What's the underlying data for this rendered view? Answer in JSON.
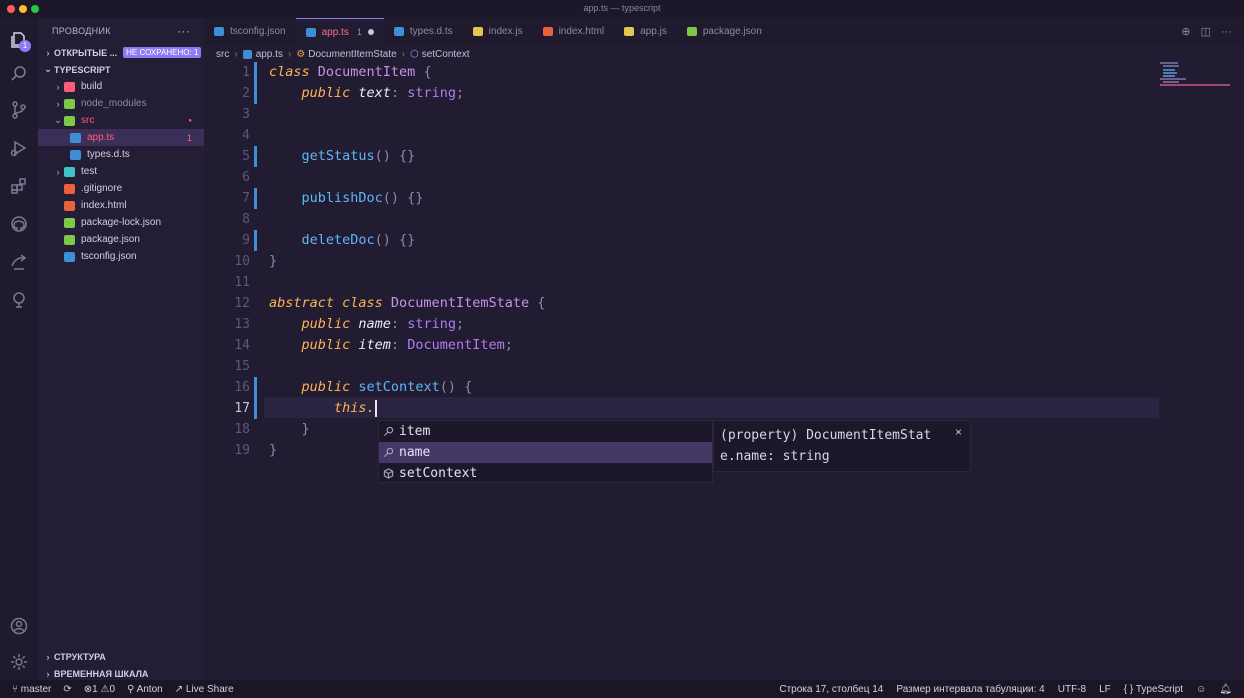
{
  "window": {
    "title": "app.ts — typescript"
  },
  "activity_bar": {
    "icons": [
      "files-icon",
      "search-icon",
      "source-control-icon",
      "run-debug-icon",
      "extensions-icon",
      "github-icon",
      "remote-icon",
      "tree-icon",
      "account-icon",
      "settings-gear-icon"
    ],
    "explorer_badge": "1"
  },
  "sidebar": {
    "header": "ПРОВОДНИК",
    "open_editors": {
      "label": "ОТКРЫТЫЕ ...",
      "badge": "НЕ СОХРАНЕНО: 1"
    },
    "project": "TYPESCRIPT",
    "tree": [
      {
        "name": "build",
        "type": "folder",
        "color": "#ff5c7a",
        "text_color": "#d3cde6"
      },
      {
        "name": "node_modules",
        "type": "folder",
        "color": "#7fc94a",
        "text_color": "#8f89a8"
      },
      {
        "name": "src",
        "type": "folder-open",
        "color": "#7fc94a",
        "text_color": "#ff5c7a"
      },
      {
        "name": "app.ts",
        "type": "ts",
        "color": "#3e8fd6",
        "text_color": "#ff5c7a",
        "count": "1",
        "selected": true
      },
      {
        "name": "types.d.ts",
        "type": "ts",
        "color": "#3e8fd6",
        "text_color": "#d3cde6"
      },
      {
        "name": "test",
        "type": "folder",
        "color": "#3ec1c9",
        "text_color": "#d3cde6"
      },
      {
        "name": ".gitignore",
        "type": "file",
        "color": "#e8623c",
        "text_color": "#d3cde6"
      },
      {
        "name": "index.html",
        "type": "file",
        "color": "#e8623c",
        "text_color": "#d3cde6"
      },
      {
        "name": "package-lock.json",
        "type": "file",
        "color": "#7fc94a",
        "text_color": "#d3cde6"
      },
      {
        "name": "package.json",
        "type": "file",
        "color": "#7fc94a",
        "text_color": "#d3cde6"
      },
      {
        "name": "tsconfig.json",
        "type": "ts",
        "color": "#3e8fd6",
        "text_color": "#d3cde6"
      }
    ],
    "structure": "СТРУКТУРА",
    "timeline": "ВРЕМЕННАЯ ШКАЛА"
  },
  "tabs": [
    {
      "label": "tsconfig.json",
      "color": "#3e8fd6"
    },
    {
      "label": "app.ts",
      "color": "#3e8fd6",
      "active": true,
      "modified": "1"
    },
    {
      "label": "types.d.ts",
      "color": "#3e8fd6"
    },
    {
      "label": "index.js",
      "color": "#e5c84b"
    },
    {
      "label": "index.html",
      "color": "#e8623c"
    },
    {
      "label": "app.js",
      "color": "#e5c84b"
    },
    {
      "label": "package.json",
      "color": "#7fc94a"
    }
  ],
  "breadcrumb": {
    "folder": "src",
    "file": "app.ts",
    "class": "DocumentItemState",
    "method": "setContext"
  },
  "code": {
    "current_line": 17,
    "lines": [
      {
        "n": "1",
        "tokens": [
          [
            "kw",
            "class "
          ],
          [
            "cls",
            "DocumentItem "
          ],
          [
            "pun",
            "{"
          ]
        ]
      },
      {
        "n": "2",
        "tokens": [
          [
            "sp",
            "    "
          ],
          [
            "kw",
            "public "
          ],
          [
            "prop",
            "text"
          ],
          [
            "pun",
            ": "
          ],
          [
            "typ",
            "string"
          ],
          [
            "pun",
            ";"
          ]
        ]
      },
      {
        "n": "3",
        "tokens": []
      },
      {
        "n": "4",
        "tokens": []
      },
      {
        "n": "5",
        "tokens": [
          [
            "sp",
            "    "
          ],
          [
            "fn",
            "getStatus"
          ],
          [
            "pun",
            "() {}"
          ]
        ]
      },
      {
        "n": "6",
        "tokens": []
      },
      {
        "n": "7",
        "tokens": [
          [
            "sp",
            "    "
          ],
          [
            "fn",
            "publishDoc"
          ],
          [
            "pun",
            "() {}"
          ]
        ]
      },
      {
        "n": "8",
        "tokens": []
      },
      {
        "n": "9",
        "tokens": [
          [
            "sp",
            "    "
          ],
          [
            "fn",
            "deleteDoc"
          ],
          [
            "pun",
            "() {}"
          ]
        ]
      },
      {
        "n": "10",
        "tokens": [
          [
            "pun",
            "}"
          ]
        ]
      },
      {
        "n": "11",
        "tokens": []
      },
      {
        "n": "12",
        "tokens": [
          [
            "kw",
            "abstract class "
          ],
          [
            "cls",
            "DocumentItemState "
          ],
          [
            "pun",
            "{"
          ]
        ]
      },
      {
        "n": "13",
        "tokens": [
          [
            "sp",
            "    "
          ],
          [
            "kw",
            "public "
          ],
          [
            "prop",
            "name"
          ],
          [
            "pun",
            ": "
          ],
          [
            "typ",
            "string"
          ],
          [
            "pun",
            ";"
          ]
        ]
      },
      {
        "n": "14",
        "tokens": [
          [
            "sp",
            "    "
          ],
          [
            "kw",
            "public "
          ],
          [
            "prop",
            "item"
          ],
          [
            "pun",
            ": "
          ],
          [
            "typ",
            "DocumentItem"
          ],
          [
            "pun",
            ";"
          ]
        ]
      },
      {
        "n": "15",
        "tokens": []
      },
      {
        "n": "16",
        "tokens": [
          [
            "sp",
            "    "
          ],
          [
            "kw",
            "public "
          ],
          [
            "fn",
            "setContext"
          ],
          [
            "pun",
            "() {"
          ]
        ]
      },
      {
        "n": "17",
        "tokens": [
          [
            "sp",
            "        "
          ],
          [
            "ths",
            "this."
          ]
        ],
        "caret": true
      },
      {
        "n": "18",
        "tokens": [
          [
            "sp",
            "    "
          ],
          [
            "pun",
            "}"
          ]
        ]
      },
      {
        "n": "19",
        "tokens": [
          [
            "pun",
            "}"
          ]
        ]
      }
    ]
  },
  "suggest": {
    "items": [
      {
        "label": "item",
        "icon": "property-icon"
      },
      {
        "label": "name",
        "icon": "property-icon",
        "selected": true
      },
      {
        "label": "setContext",
        "icon": "method-icon"
      }
    ],
    "details_line1": "(property) DocumentItemStat",
    "details_line2": "e.name: string",
    "close": "×"
  },
  "status": {
    "branch": "master",
    "errors": "1",
    "warnings": "0",
    "user": "Anton",
    "live_share": "Live Share",
    "position": "Строка 17, столбец 14",
    "indent": "Размер интервала табуляции: 4",
    "encoding": "UTF-8",
    "eol": "LF",
    "language": "TypeScript"
  }
}
